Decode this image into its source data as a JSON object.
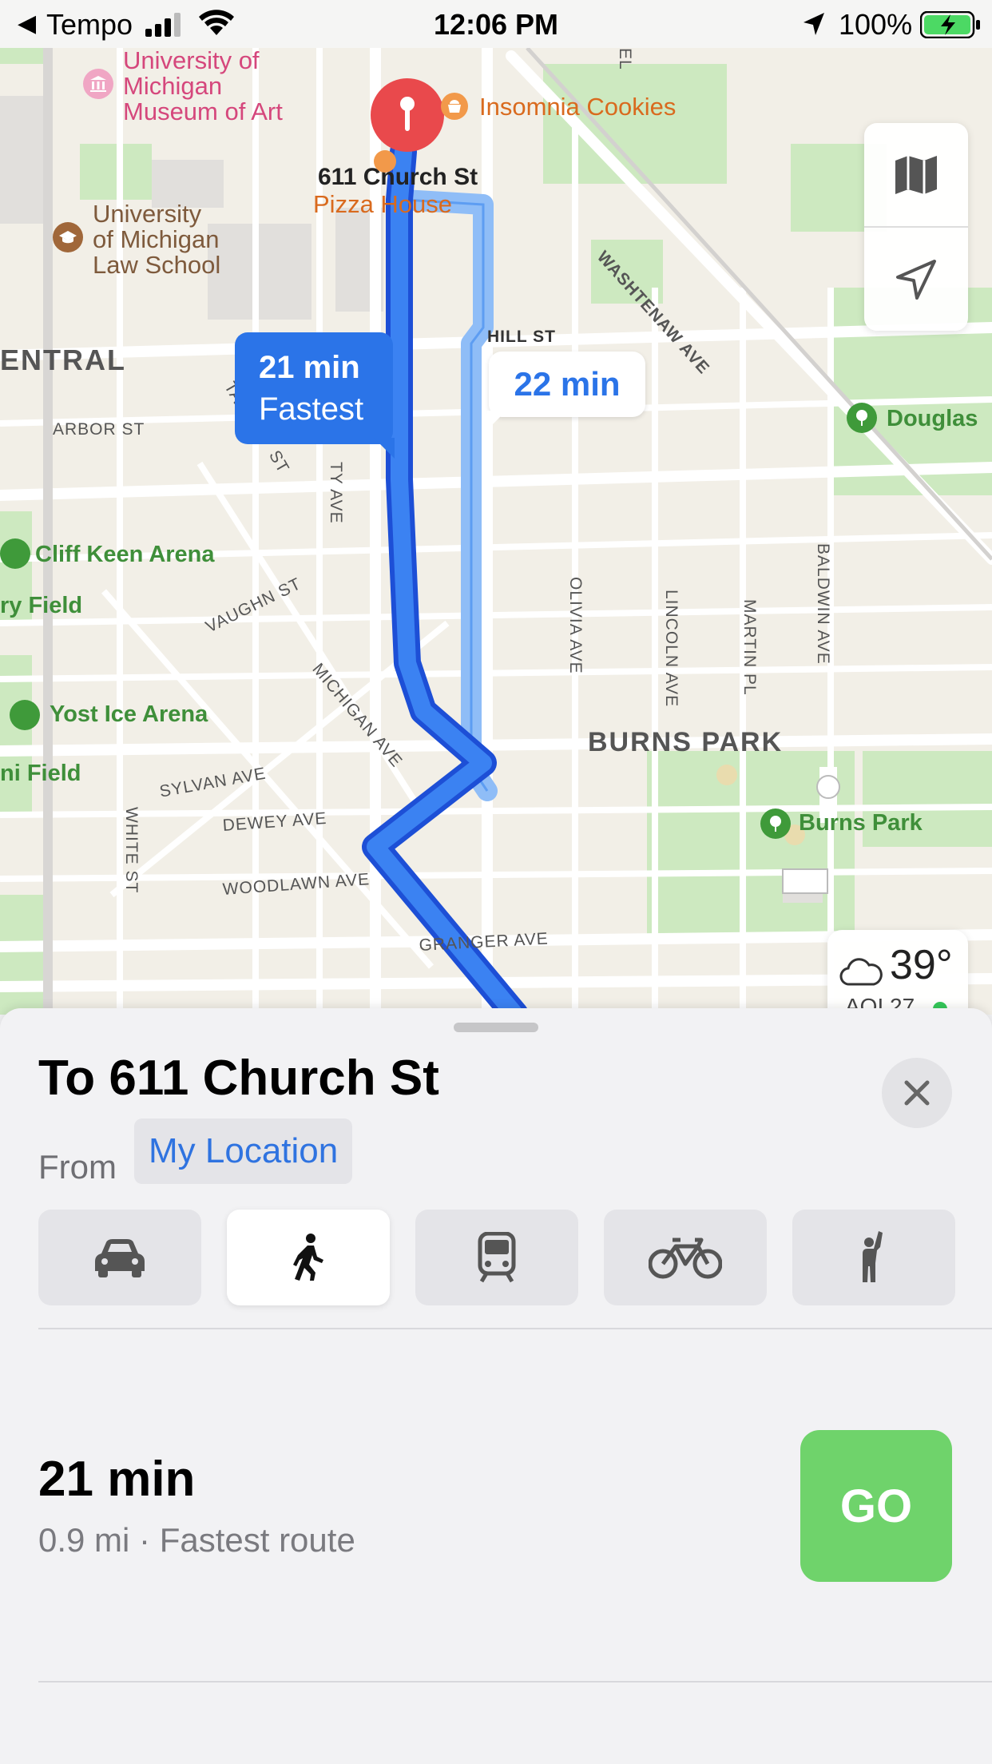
{
  "status_bar": {
    "back_app": "Tempo",
    "time": "12:06 PM",
    "battery": "100%"
  },
  "map": {
    "pois": {
      "museum": "University of\nMichigan\nMuseum of Art",
      "cookies": "Insomnia Cookies",
      "destination": "611 Church St",
      "pizza": "Pizza House",
      "law_school": "University\nof Michigan\nLaw School",
      "cliff_keen": "Cliff Keen Arena",
      "yost": "Yost Ice Arena",
      "douglas": "Douglas",
      "burns_park_poi": "Burns Park",
      "field1": "ry Field",
      "field2": "ni Field"
    },
    "districts": {
      "central": "ENTRAL",
      "burns_park": "BURNS PARK"
    },
    "streets": {
      "hill": "HILL ST",
      "washtenaw": "WASHTENAW AVE",
      "arbor": "ARBOR ST",
      "vaughn": "VAUGHN ST",
      "michigan": "MICHIGAN AVE",
      "sylvan": "SYLVAN AVE",
      "dewey": "DEWEY AVE",
      "woodlawn": "WOODLAWN AVE",
      "granger": "GRANGER AVE",
      "white": "WHITE ST",
      "olivia": "OLIVIA AVE",
      "lincoln": "LINCOLN AVE",
      "martin": "MARTIN PL",
      "baldwin": "BALDWIN AVE",
      "tappan": "TA",
      "tappan2": "ST",
      "church": "TY AVE",
      "el": "EL"
    },
    "routes": {
      "fastest_time": "21 min",
      "fastest_label": "Fastest",
      "alternate_time": "22 min"
    },
    "weather": {
      "temp": "39°",
      "aqi": "AQI 27"
    },
    "icons": {
      "map_mode": "map-icon",
      "tracking": "location-arrow-icon",
      "weather": "cloud-icon"
    }
  },
  "sheet": {
    "title": "To 611 Church St",
    "from_label": "From",
    "from_value": "My Location",
    "modes": [
      {
        "name": "drive",
        "icon": "car-icon",
        "active": false
      },
      {
        "name": "walk",
        "icon": "walk-icon",
        "active": true
      },
      {
        "name": "transit",
        "icon": "train-icon",
        "active": false
      },
      {
        "name": "cycle",
        "icon": "bike-icon",
        "active": false
      },
      {
        "name": "rideshare",
        "icon": "hail-icon",
        "active": false
      }
    ],
    "route": {
      "time": "21 min",
      "details": "0.9 mi · Fastest route",
      "go_label": "GO"
    }
  },
  "colors": {
    "route_blue": "#2b74e8",
    "alt_route": "#8fbdf7",
    "go_green": "#6fd36b",
    "accent_text": "#2f73e0"
  }
}
